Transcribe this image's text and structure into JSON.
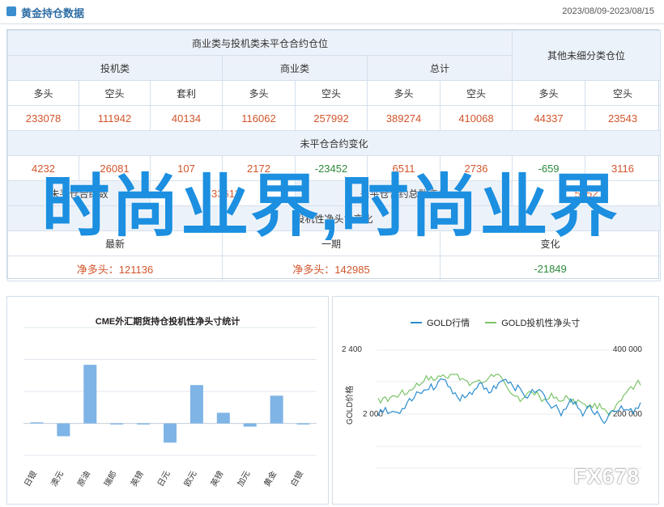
{
  "header": {
    "title": "黄金持仓数据",
    "date_range": "2023/08/09-2023/08/15"
  },
  "position_table": {
    "top_group": "商业类与投机类未平仓合约仓位",
    "other_group": "其他未细分类仓位",
    "groups": [
      "投机类",
      "商业类",
      "总计"
    ],
    "sub_headers": [
      "多头",
      "空头",
      "套利",
      "多头",
      "空头",
      "多头",
      "空头",
      "多头",
      "空头"
    ],
    "values": [
      "233078",
      "111942",
      "40134",
      "116062",
      "257992",
      "389274",
      "410068",
      "44337",
      "23543"
    ],
    "change_title": "未平仓合约变化",
    "changes": [
      "4232",
      "26081",
      "107",
      "2172",
      "-23452",
      "6511",
      "2736",
      "-659",
      "3116"
    ],
    "total_label": "未平仓合约数",
    "total_value": "433611",
    "total_change_label": "未平仓合约总数变化",
    "total_change_value": "5852",
    "net_title": "投机性净头寸变化",
    "latest_label": "最新",
    "prev_label": "一期",
    "change_label": "变化",
    "net_long_latest": "净多头：121136",
    "net_long_prev": "净多头：142985",
    "net_change": "-21849"
  },
  "overlay_text": "时尚业界,时尚业界",
  "chart_data": [
    {
      "type": "bar",
      "title": "CME外汇期货持仓投机性净头寸统计",
      "categories": [
        "日银",
        "澳元",
        "原油",
        "瑞郎",
        "英镑",
        "日元",
        "欧元",
        "英镑",
        "加元",
        "黄金",
        "白银"
      ],
      "values": [
        1,
        -12,
        55,
        -1,
        -1,
        -18,
        36,
        10,
        -3,
        26,
        -1
      ],
      "ylim": [
        -42,
        90
      ],
      "color": "#7fb4e6"
    },
    {
      "type": "line",
      "legend": [
        "GOLD行情",
        "GOLD投机性净头寸"
      ],
      "left_axis_label": "GOLD价格",
      "left_ticks": [
        "2 400",
        "2 000"
      ],
      "right_ticks": [
        "400 000",
        "200 000"
      ],
      "series": [
        {
          "name": "GOLD行情",
          "color": "#7cc46a"
        },
        {
          "name": "GOLD投机性净头寸",
          "color": "#2b8ccf"
        }
      ]
    }
  ],
  "watermark": "FX678"
}
